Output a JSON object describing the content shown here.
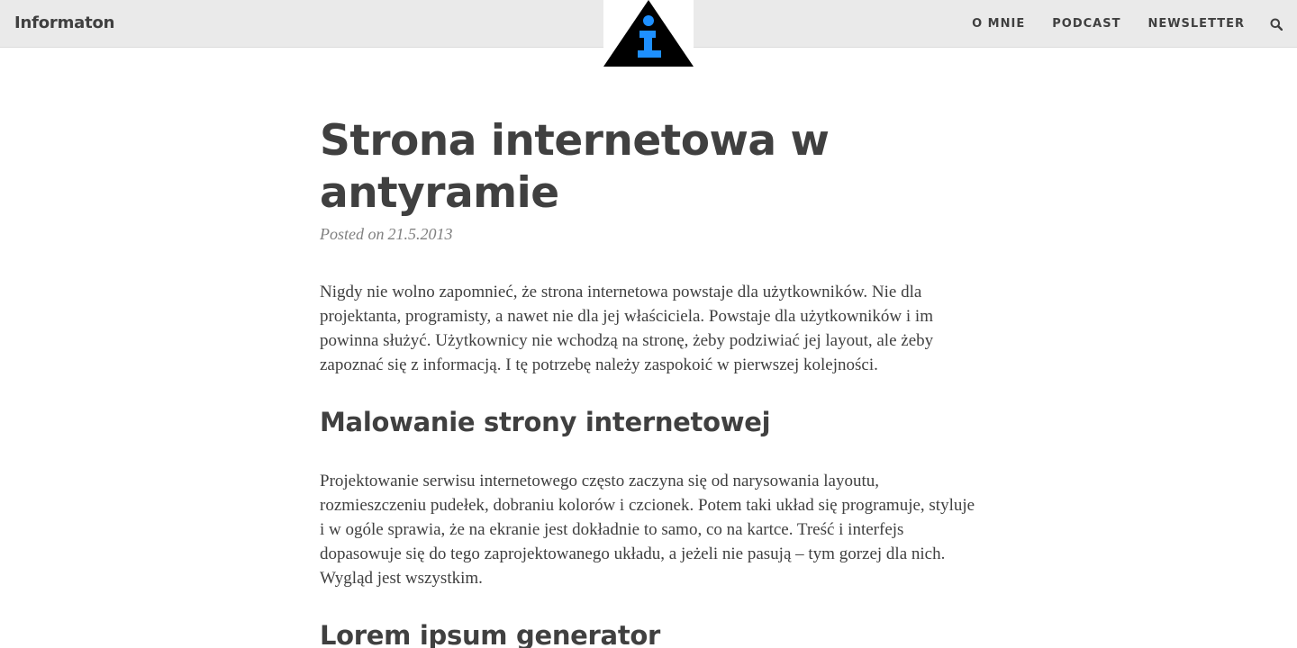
{
  "navbar": {
    "brand": "Informaton",
    "logo_icon": "info-triangle-logo",
    "links": [
      "O MNIE",
      "PODCAST",
      "NEWSLETTER"
    ],
    "search_icon": "search-icon"
  },
  "post": {
    "title": "Strona internetowa w antyramie",
    "meta_prefix": "Posted on",
    "date": "21.5.2013",
    "intro": "Nigdy nie wolno zapomnieć, że strona internetowa powstaje dla użytkowników. Nie dla projektanta, programisty, a nawet nie dla jej właściciela. Powstaje dla użytkowników i im powinna służyć. Użytkownicy nie wchodzą na stronę, żeby podziwiać jej layout, ale żeby zapoznać się z informacją. I tę potrzebę należy zaspokoić w pierwszej kolejności.",
    "sections": [
      {
        "heading": "Malowanie strony internetowej",
        "text": "Projektowanie serwisu internetowego często zaczyna się od narysowania layoutu, rozmieszczeniu pudełek, dobraniu kolorów i czcionek. Potem taki układ się programuje, styluje i w ogóle sprawia, że na ekranie jest dokładnie to samo, co na kartce. Treść i interfejs dopasowuje się do tego zaprojektowanego układu, a jeżeli nie pasują – tym gorzej dla nich. Wygląd jest wszystkim."
      },
      {
        "heading": "Lorem ipsum generator"
      }
    ]
  },
  "colors": {
    "navbar_bg": "#eaeaea",
    "text": "#404040",
    "meta": "#808080",
    "logo_accent": "#1e90ff"
  }
}
